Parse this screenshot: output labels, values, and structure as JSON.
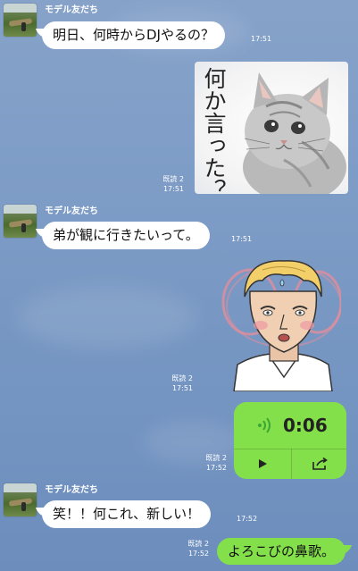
{
  "contact_name": "モデル友だち",
  "messages": [
    {
      "sender": "モデル友だち",
      "text": "明日、何時からDJやるの？",
      "time": "17:51"
    },
    {
      "type": "sticker",
      "text": "何か言った？",
      "read": "既読 2",
      "time": "17:51"
    },
    {
      "sender": "モデル友だち",
      "text": "弟が観に行きたいって。",
      "time": "17:51"
    },
    {
      "type": "sticker",
      "read": "既読 2",
      "time": "17:51"
    },
    {
      "type": "voice",
      "duration": "0:06",
      "read": "既読 2",
      "time": "17:52"
    },
    {
      "sender": "モデル友だち",
      "text": "笑！！何これ、新しい！",
      "time": "17:52"
    },
    {
      "text": "よろこびの鼻歌。",
      "read": "既読 2",
      "time": "17:52"
    }
  ],
  "icons": {
    "avatar": "landscape-photo",
    "voice_wave": "sound-wave-icon",
    "play": "play-icon",
    "share": "share-icon"
  },
  "colors": {
    "background": "#7d9cc6",
    "incoming_bubble": "#ffffff",
    "outgoing_bubble": "#84e04a"
  }
}
